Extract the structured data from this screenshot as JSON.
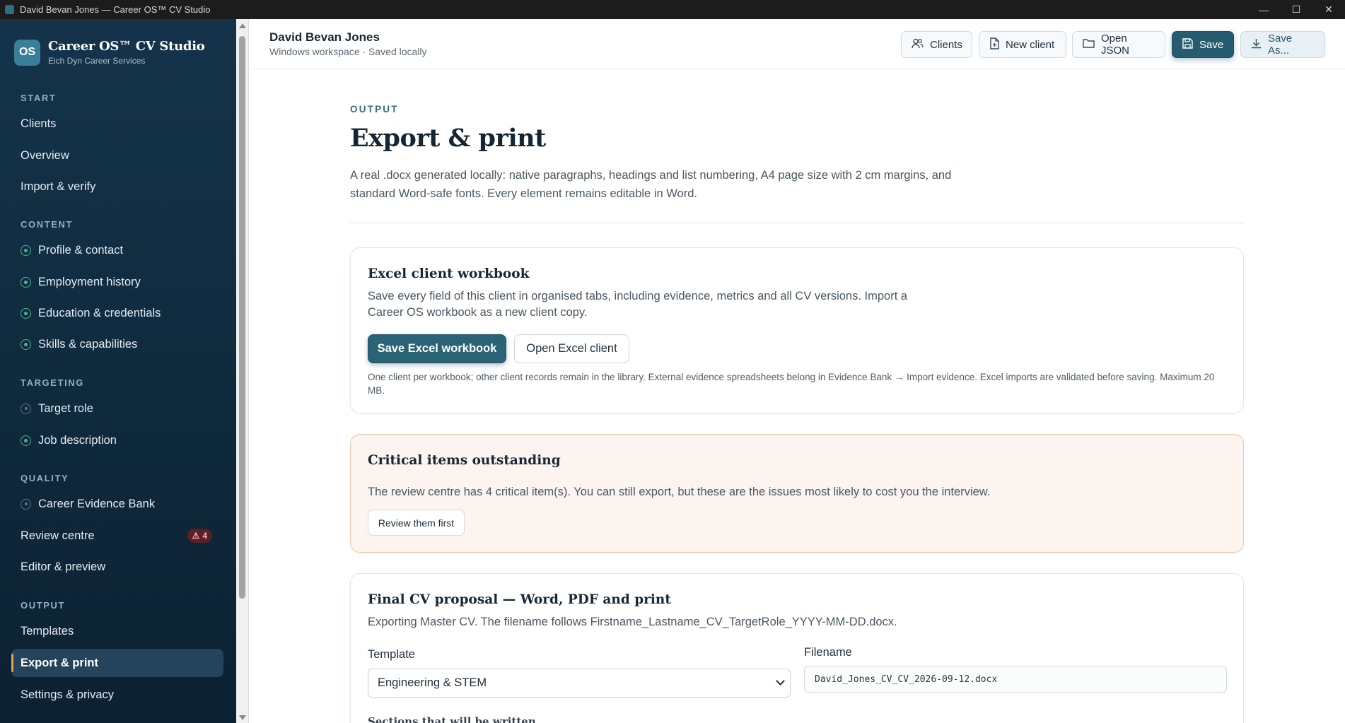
{
  "window": {
    "title": "David Bevan Jones — Career OS™ CV Studio"
  },
  "brand": {
    "logo": "OS",
    "name": "Career OS™ CV Studio",
    "subtitle": "Eich Dyn Career Services"
  },
  "sidebar": {
    "sections": {
      "start": "START",
      "content": "CONTENT",
      "targeting": "TARGETING",
      "quality": "QUALITY",
      "output": "OUTPUT"
    },
    "items": {
      "clients": "Clients",
      "overview": "Overview",
      "import_verify": "Import & verify",
      "profile_contact": "Profile & contact",
      "employment_history": "Employment history",
      "education_credentials": "Education & credentials",
      "skills_capabilities": "Skills & capabilities",
      "target_role": "Target role",
      "job_description": "Job description",
      "evidence_bank": "Career Evidence Bank",
      "review_centre": "Review centre",
      "review_badge": "4",
      "editor_preview": "Editor & preview",
      "templates": "Templates",
      "export_print": "Export & print",
      "settings_privacy": "Settings & privacy"
    },
    "active": "Export & print"
  },
  "header": {
    "client_name": "David Bevan Jones",
    "client_status": "Windows workspace · Saved locally",
    "buttons": {
      "clients": "Clients",
      "new_client": "New client",
      "open_json": "Open JSON",
      "save": "Save",
      "save_as": "Save As..."
    }
  },
  "page": {
    "eyebrow": "OUTPUT",
    "title": "Export & print",
    "lead": "A real .docx generated locally: native paragraphs, headings and list numbering, A4 page size with 2 cm margins, and standard Word-safe fonts. Every element remains editable in Word."
  },
  "excel_card": {
    "title": "Excel client workbook",
    "description": "Save every field of this client in organised tabs, including evidence, metrics and all CV versions. Import a Career OS workbook as a new client copy.",
    "save_button": "Save Excel workbook",
    "open_button": "Open Excel client",
    "note": "One client per workbook; other client records remain in the library. External evidence spreadsheets belong in Evidence Bank → Import evidence. Excel imports are validated before saving. Maximum 20 MB."
  },
  "critical_card": {
    "title": "Critical items outstanding",
    "description": "The review centre has 4 critical item(s). You can still export, but these are the issues most likely to cost you the interview.",
    "button": "Review them first"
  },
  "final_card": {
    "title": "Final CV proposal — Word, PDF and print",
    "description": "Exporting Master CV. The filename follows Firstname_Lastname_CV_TargetRole_YYYY-MM-DD.docx.",
    "template_label": "Template",
    "template_value": "Engineering & STEM",
    "filename_label": "Filename",
    "filename_value": "David_Jones_CV_CV_2026-09-12.docx",
    "sections_heading": "Sections that will be written"
  }
}
